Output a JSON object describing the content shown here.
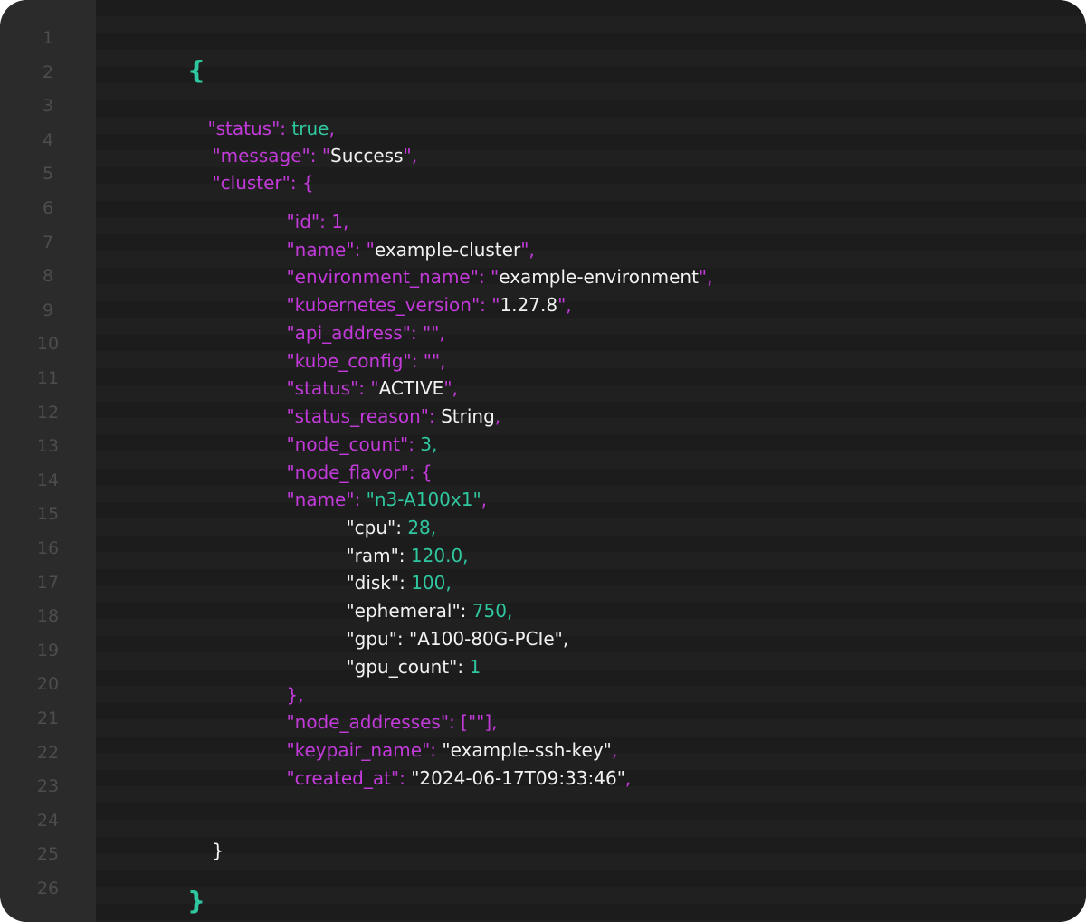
{
  "editor": {
    "line_numbers": [
      "1",
      "2",
      "3",
      "4",
      "5",
      "6",
      "7",
      "8",
      "9",
      "10",
      "11",
      "12",
      "13",
      "14",
      "15",
      "16",
      "17",
      "18",
      "19",
      "20",
      "21",
      "22",
      "23",
      "24",
      "25",
      "26"
    ],
    "code": {
      "open_brace": "{",
      "close_brace": "}",
      "inner_close_brace": "}",
      "status": {
        "key": "\"status\"",
        "value": "true"
      },
      "message": {
        "key": "\"message\"",
        "value": "Success"
      },
      "cluster_key": "\"cluster\"",
      "cluster": {
        "id": {
          "key": "\"id\"",
          "value": "1"
        },
        "name": {
          "key": "\"name\"",
          "value": "example-cluster"
        },
        "environment_name": {
          "key": "\"environment_name\"",
          "value": "example-environment"
        },
        "kubernetes_version": {
          "key": "\"kubernetes_version\"",
          "value": "1.27.8"
        },
        "api_address": {
          "key": "\"api_address\""
        },
        "kube_config": {
          "key": "\"kube_config\""
        },
        "status": {
          "key": "\"status\"",
          "value": "ACTIVE"
        },
        "status_reason": {
          "key": "\"status_reason\"",
          "value": "String"
        },
        "node_count": {
          "key": "\"node_count\"",
          "value": "3"
        },
        "node_flavor_key": "\"node_flavor\"",
        "flavor_name": {
          "key": "\"name\"",
          "value": "\"n3-A100x1\""
        },
        "node_flavor": {
          "cpu": {
            "key": "\"cpu\"",
            "value": "28"
          },
          "ram": {
            "key": "\"ram\"",
            "value": "120.0"
          },
          "disk": {
            "key": "\"disk\"",
            "value": "100"
          },
          "ephemeral": {
            "key": "\"ephemeral\"",
            "value": "750"
          },
          "gpu": {
            "key": "\"gpu\"",
            "value": "\"A100-80G-PCIe\""
          },
          "gpu_count": {
            "key": "\"gpu_count\"",
            "value": "1"
          }
        },
        "node_addresses": {
          "key": "\"node_addresses\"",
          "value": "[\"\"]"
        },
        "keypair_name": {
          "key": "\"keypair_name\"",
          "value": "\"example-ssh-key\""
        },
        "created_at": {
          "key": "\"created_at\"",
          "value": "\"2024-06-17T09:33:46\""
        }
      }
    }
  }
}
